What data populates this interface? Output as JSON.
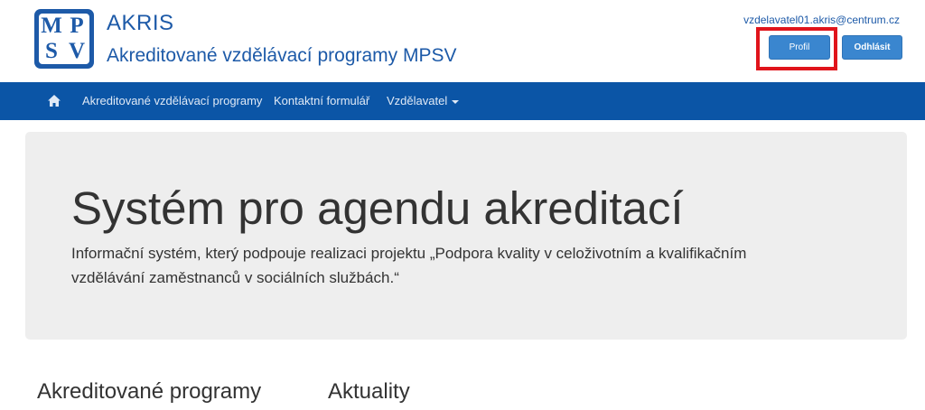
{
  "header": {
    "logo": {
      "letters": [
        "M",
        "P",
        "S",
        "V"
      ]
    },
    "title": "AKRIS",
    "subtitle": "Akreditované vzdělávací programy MPSV",
    "user_email": "vzdelavatel01.akris@centrum.cz",
    "profile_button": "Profil",
    "logout_button": "Odhlásit",
    "highlight_color": "#e0141b"
  },
  "nav": {
    "background": "#0b55a6",
    "home_icon": "home-icon",
    "items": [
      {
        "label": "Akreditované vzdělávací programy"
      },
      {
        "label": "Kontaktní formulář"
      },
      {
        "label": "Vzdělavatel",
        "dropdown": true
      }
    ]
  },
  "hero": {
    "title": "Systém pro agendu akreditací",
    "text": "Informační systém, který podpouje realizaci projektu „Podpora kvality v celoživotním a kvalifikačním vzdělávání zaměstnanců v sociálních službách.“"
  },
  "sections": {
    "programs_title": "Akreditované programy",
    "news_title": "Aktuality"
  },
  "colors": {
    "brand": "#1d5aa8",
    "button": "#3a86cf"
  }
}
